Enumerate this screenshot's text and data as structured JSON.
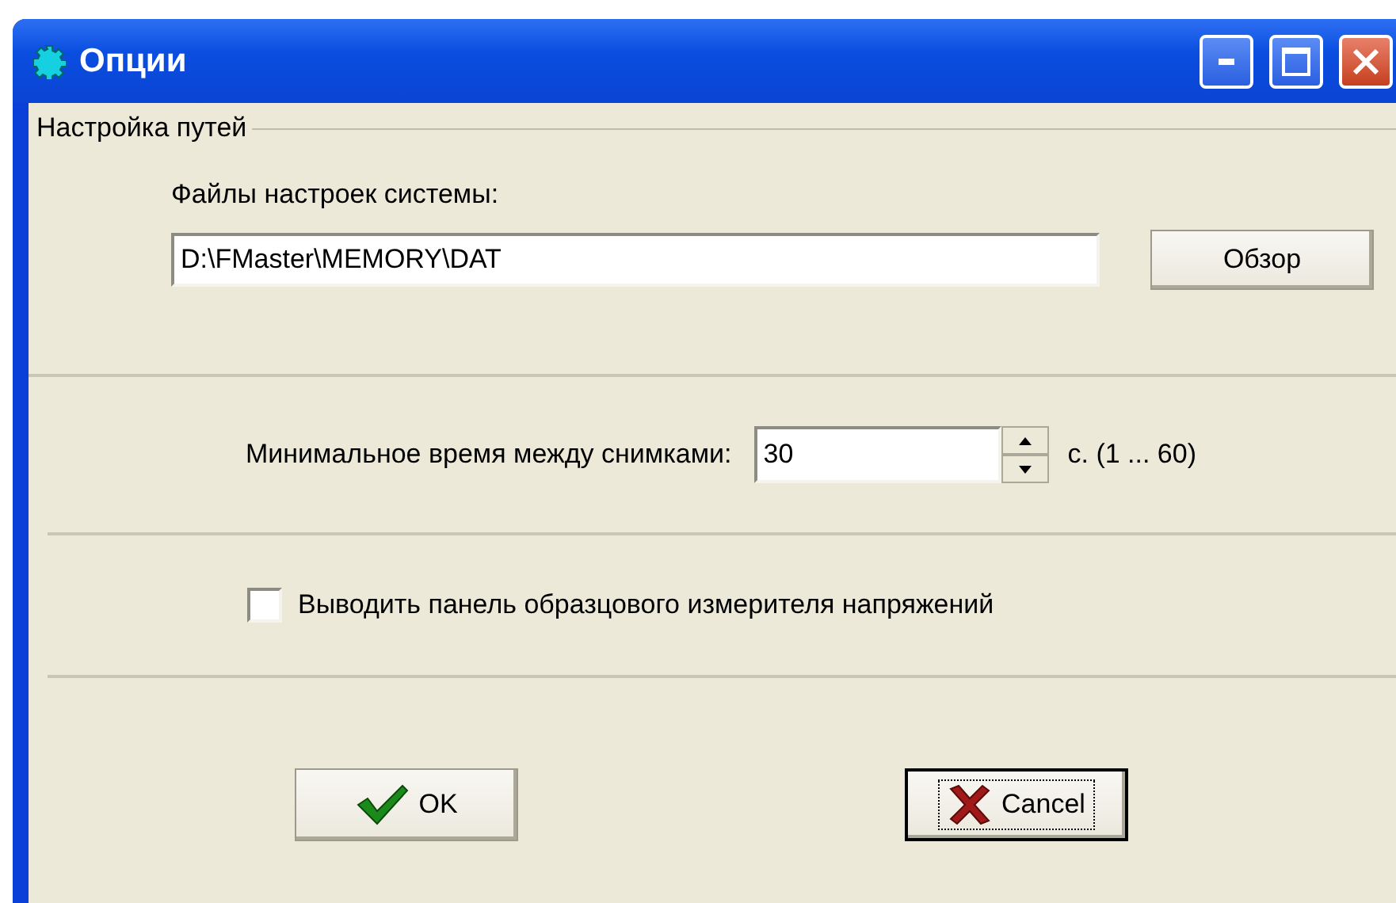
{
  "window": {
    "title": "Опции"
  },
  "paths_group": {
    "legend": "Настройка путей",
    "label": "Файлы настроек системы:",
    "path": "D:\\FMaster\\MEMORY\\DAT",
    "browse_button": "Обзор"
  },
  "interval": {
    "label": "Минимальное время между снимками:",
    "value": "30",
    "range": "с. (1 ... 60)"
  },
  "voltmeter_checkbox": {
    "label": "Выводить панель образцового измерителя напряжений",
    "checked": false
  },
  "buttons": [
    {
      "kind": "ok",
      "label": "OK",
      "default": false
    },
    {
      "kind": "cancel",
      "label": "Cancel",
      "default": true
    }
  ]
}
